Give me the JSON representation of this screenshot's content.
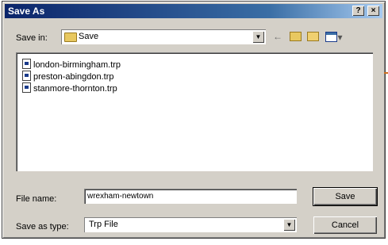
{
  "window": {
    "title": "Save As",
    "help_label": "?",
    "close_label": "×"
  },
  "toolbar": {
    "save_in_label": "Save in:",
    "save_in_value": "Save",
    "back_glyph": "←",
    "view_glyph": "▾"
  },
  "files": [
    {
      "name": "london-birmingham.trp"
    },
    {
      "name": "preston-abingdon.trp"
    },
    {
      "name": "stanmore-thornton.trp"
    }
  ],
  "form": {
    "file_name_label": "File name:",
    "file_name_value": "wrexham-newtown",
    "save_as_type_label": "Save as type:",
    "save_as_type_value": "Trp File"
  },
  "buttons": {
    "save": "Save",
    "cancel": "Cancel"
  },
  "colors": {
    "titlebar": "#0a246a",
    "face": "#d4d0c8",
    "accent_marker": "#d07020"
  }
}
